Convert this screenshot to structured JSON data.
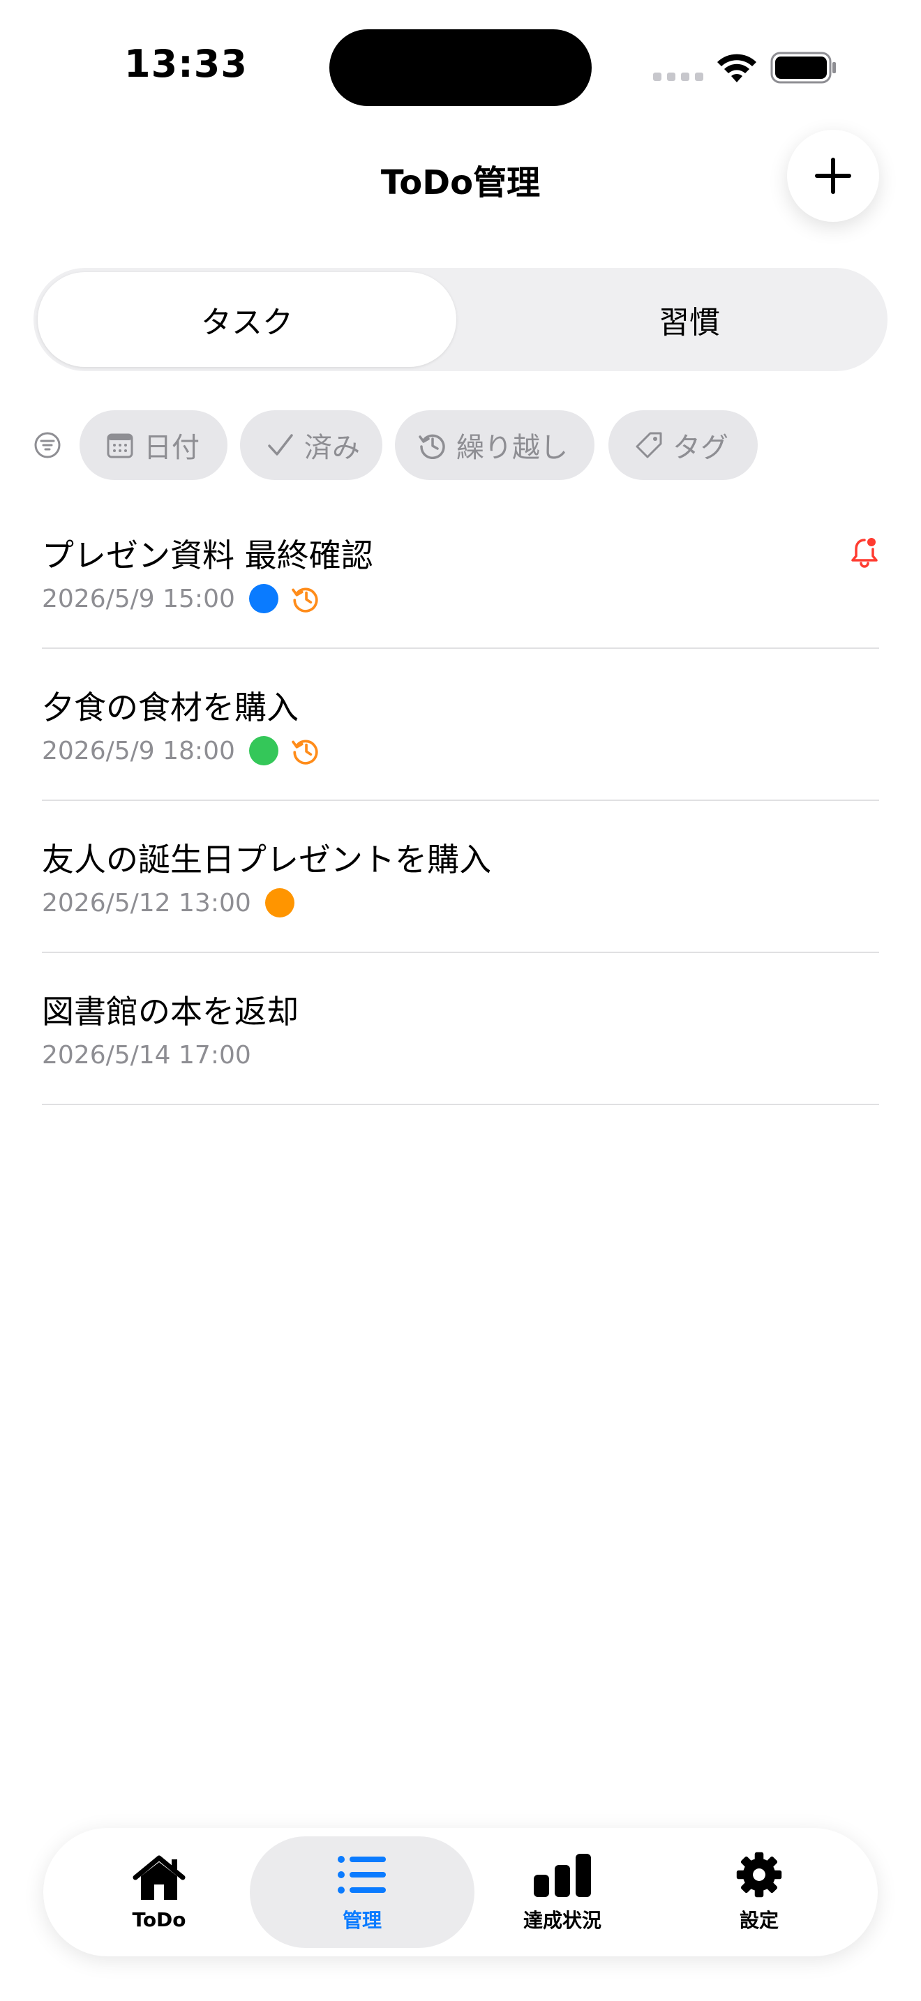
{
  "status_bar": {
    "time": "13:33"
  },
  "header": {
    "title": "ToDo管理"
  },
  "segments": [
    {
      "label": "タスク",
      "active": true
    },
    {
      "label": "習慣",
      "active": false
    }
  ],
  "filters": [
    {
      "label": "日付",
      "icon": "calendar-icon"
    },
    {
      "label": "済み",
      "icon": "check-icon"
    },
    {
      "label": "繰り越し",
      "icon": "history-icon"
    },
    {
      "label": "タグ",
      "icon": "tag-icon"
    }
  ],
  "tasks": [
    {
      "title": "プレゼン資料 最終確認",
      "date": "2026/5/9 15:00",
      "tag_color": "#0a7bff",
      "carried_over": true,
      "reminder": true
    },
    {
      "title": "夕食の食材を購入",
      "date": "2026/5/9 18:00",
      "tag_color": "#34c759",
      "carried_over": true,
      "reminder": false
    },
    {
      "title": "友人の誕生日プレゼントを購入",
      "date": "2026/5/12 13:00",
      "tag_color": "#ff9500",
      "carried_over": false,
      "reminder": false
    },
    {
      "title": "図書館の本を返却",
      "date": "2026/5/14 17:00",
      "tag_color": null,
      "carried_over": false,
      "reminder": false
    }
  ],
  "colors": {
    "accent": "#0a7bff",
    "carry_over": "#ff8c1a",
    "reminder": "#ff3b30"
  },
  "tab_bar": [
    {
      "label": "ToDo",
      "icon": "house-icon",
      "active": false
    },
    {
      "label": "管理",
      "icon": "list-icon",
      "active": true
    },
    {
      "label": "達成状況",
      "icon": "chart-icon",
      "active": false
    },
    {
      "label": "設定",
      "icon": "gear-icon",
      "active": false
    }
  ]
}
